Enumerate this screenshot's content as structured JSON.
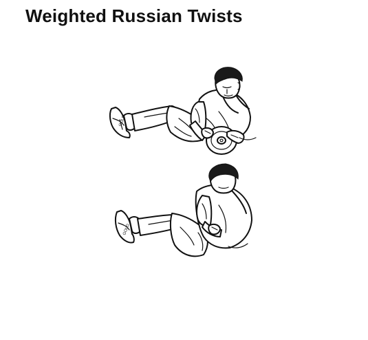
{
  "page": {
    "title": "Weighted Russian Twists"
  },
  "illustrations": [
    {
      "icon": "weighted-russian-twist-start-illustration"
    },
    {
      "icon": "weighted-russian-twist-rotated-illustration"
    }
  ],
  "colors": {
    "text": "#111111",
    "background": "#ffffff",
    "ink": "#111111"
  }
}
